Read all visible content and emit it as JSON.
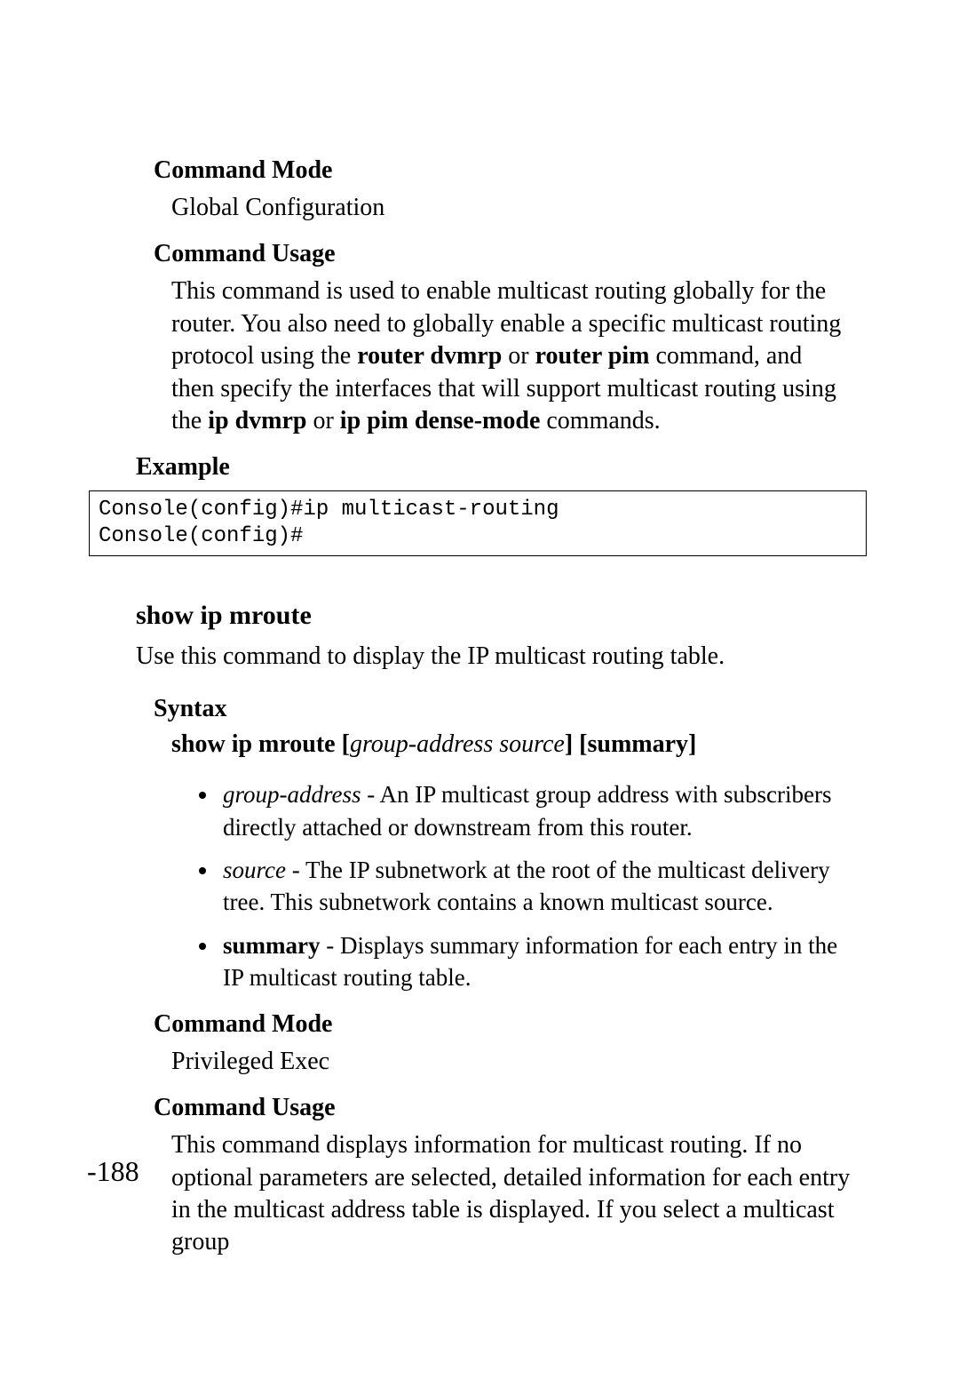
{
  "section1": {
    "mode_heading": "Command Mode",
    "mode_text": "Global Configuration",
    "usage_heading": "Command Usage",
    "usage_before1": "This command is used to enable multicast routing globally for the router. You also need to globally enable a specific multicast routing protocol using the ",
    "usage_bold1": "router dvmrp",
    "usage_mid1": " or ",
    "usage_bold2": "router pim",
    "usage_mid2": " command, and then specify the interfaces that will support multicast routing using the ",
    "usage_bold3": "ip dvmrp",
    "usage_mid3": " or ",
    "usage_bold4": "ip pim dense-mode",
    "usage_after": " commands.",
    "example_heading": "Example",
    "code": "Console(config)#ip multicast-routing\nConsole(config)#"
  },
  "section2": {
    "cmd_name": "show ip mroute",
    "cmd_desc": "Use this command to display the IP multicast routing table.",
    "syntax_heading": "Syntax",
    "syntax_cmd": "show ip mroute",
    "syntax_args": "group-address source",
    "syntax_opt": "summary",
    "params": [
      {
        "term": "group-address",
        "term_style": "italic",
        "sep": " - ",
        "desc": "An IP multicast group address with subscribers directly attached or downstream from this router."
      },
      {
        "term": "source",
        "term_style": "italic",
        "sep": " - ",
        "desc": "The IP subnetwork at the root of the multicast delivery tree. This subnetwork contains a known multicast source."
      },
      {
        "term": "summary",
        "term_style": "bold",
        "sep": " - ",
        "desc": "Displays summary information for each entry in the IP multicast routing table."
      }
    ],
    "mode_heading": "Command Mode",
    "mode_text": "Privileged Exec",
    "usage_heading": "Command Usage",
    "usage_text": "This command displays information for multicast routing. If no optional parameters are selected, detailed information for each entry in the multicast address table is displayed. If you select a multicast group"
  },
  "page_number": "-188"
}
